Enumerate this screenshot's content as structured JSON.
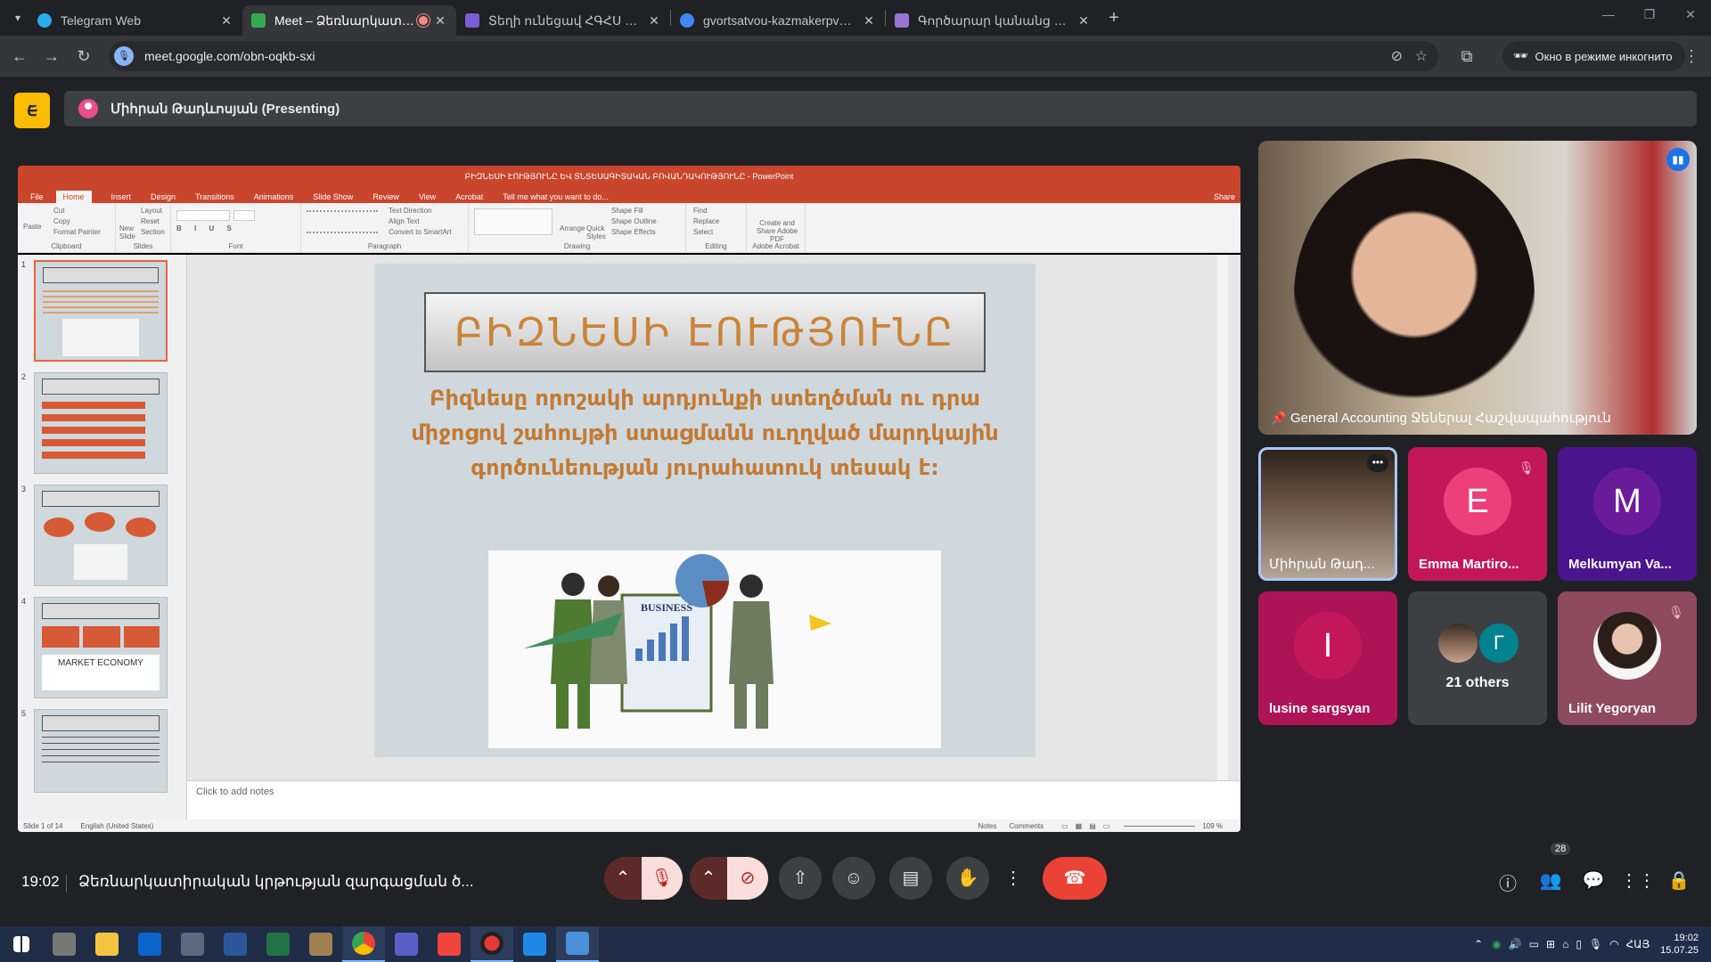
{
  "browser": {
    "tabs": [
      {
        "title": "Telegram Web",
        "favicon_color": "#2aabee",
        "active": false
      },
      {
        "title": "Meet – Ձեռնարկատիրակ",
        "favicon_color": "#34a853",
        "active": true
      },
      {
        "title": "Տեղի ունեցավ ՀԳՀՍ Խորհրդ",
        "favicon_color": "#7b5cd6",
        "active": false
      },
      {
        "title": "gvortsatvou-kazmakerpvouthy",
        "favicon_color": "#4285f4",
        "active": false
      },
      {
        "title": "Գործարար կանանց ակումբ",
        "favicon_color": "#9575cd",
        "active": false
      }
    ],
    "new_tab": "+",
    "url": "meet.google.com/obn-oqkb-sxi",
    "incognito_label": "Окно в режиме инкогнито"
  },
  "meet": {
    "logo_glyph": "ᰀ",
    "presenter_label": "Միհրան Թադևոսյան (Presenting)",
    "presentation": {
      "app_title": "ԲԻԶՆԵՍԻ ԷՈՒԹՅՈՒՆԸ ԵՎ ՏՆՏԵՍԱԳԻՏԱԿԱՆ ԲՈՎԱՆԴԱԿՈՒԹՅՈՒՆԸ - PowerPoint",
      "menu": [
        "File",
        "Home",
        "Insert",
        "Design",
        "Transitions",
        "Animations",
        "Slide Show",
        "Review",
        "View",
        "Acrobat",
        "Tell me what you want to do..."
      ],
      "share_label": "Share",
      "ribbon_groups": [
        "Clipboard",
        "Slides",
        "Font",
        "Paragraph",
        "Drawing",
        "Editing",
        "Adobe Acrobat"
      ],
      "ribbon_items": {
        "paste": "Paste",
        "cut": "Cut",
        "copy": "Copy",
        "format_painter": "Format Painter",
        "new_slide": "New Slide",
        "layout": "Layout",
        "reset": "Reset",
        "section": "Section",
        "text_direction": "Text Direction",
        "align_text": "Align Text",
        "convert_smartart": "Convert to SmartArt",
        "arrange": "Arrange",
        "quick_styles": "Quick Styles",
        "shape_fill": "Shape Fill",
        "shape_outline": "Shape Outline",
        "shape_effects": "Shape Effects",
        "find": "Find",
        "replace": "Replace",
        "select": "Select",
        "create_share_pdf": "Create and Share Adobe PDF"
      },
      "thumb_numbers": [
        "1",
        "2",
        "3",
        "4",
        "5"
      ],
      "thumb4_caption": "MARKET ECONOMY",
      "slide_title": "ԲԻԶՆԵՍԻ ԷՈՒԹՅՈՒՆԸ",
      "slide_body": "Բիզնեսը որոշակի արդյունքի ստեղծման ու դրա միջոցով շահույթի ստացմանն ուղղված մարդկային գործունեության յուրահատուկ տեսակ է:",
      "image_label": "BUSINESS",
      "notes_placeholder": "Click to add notes",
      "status_slide": "Slide 1 of 14",
      "status_lang": "English (United States)",
      "status_notes": "Notes",
      "status_comments": "Comments",
      "zoom": "109 %"
    },
    "participants": [
      {
        "name": "General Accounting Ջեներալ Հաշվապահություն",
        "kind": "video-main"
      },
      {
        "name": "Միհրան Թադ...",
        "kind": "video"
      },
      {
        "name": "Emma Martiro...",
        "initial": "E",
        "bg": "#c2185b",
        "circle": "#ec407a",
        "muted": true
      },
      {
        "name": "Melkumyan Va...",
        "initial": "M",
        "bg": "#4a148c",
        "circle": "#6a1b9a",
        "muted": false
      },
      {
        "name": "lusine sargsyan",
        "initial": "I",
        "bg": "#ad1457",
        "circle": "#c2185b",
        "muted": false
      },
      {
        "name": "21 others",
        "initial": "Г",
        "bg": "#3c4043",
        "circle": "#00838f",
        "muted": false
      },
      {
        "name": "Lilit Yegoryan",
        "bg": "#8e4a5f",
        "muted": true
      }
    ],
    "time": "19:02",
    "meeting_title": "Ձեռնարկատիրական կրթության զարգացման ծ...",
    "people_count": "28"
  },
  "taskbar": {
    "lang": "ՀԱՅ",
    "time": "19:02",
    "date": "15.07.25"
  }
}
